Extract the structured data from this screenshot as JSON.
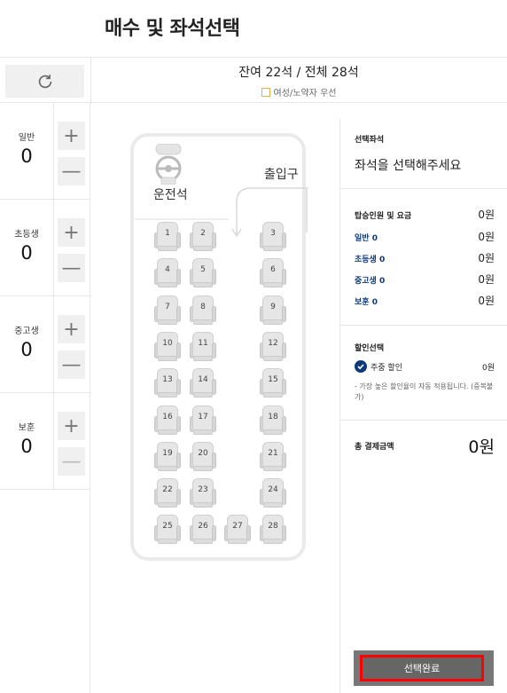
{
  "page": {
    "title": "매수 및 좌석선택"
  },
  "topbar": {
    "refresh_icon": "refresh-icon",
    "seat_summary": "잔여 22석 / 전체 28석",
    "priority_label": "여성/노약자 우선"
  },
  "counters": [
    {
      "label": "일반",
      "value": "0"
    },
    {
      "label": "초등생",
      "value": "0"
    },
    {
      "label": "중고생",
      "value": "0"
    },
    {
      "label": "보훈",
      "value": "0"
    }
  ],
  "counter_buttons": {
    "plus": "+",
    "minus": "—"
  },
  "bus": {
    "driver_label": "운전석",
    "exit_label": "출입구",
    "seats": [
      "1",
      "2",
      "3",
      "4",
      "5",
      "6",
      "7",
      "8",
      "9",
      "10",
      "11",
      "12",
      "13",
      "14",
      "15",
      "16",
      "17",
      "18",
      "19",
      "20",
      "21",
      "22",
      "23",
      "24",
      "25",
      "26",
      "27",
      "28"
    ]
  },
  "right": {
    "selected_seat_title": "선택좌석",
    "selected_seat_msg": "좌석을 선택해주세요",
    "fare_title": "탑승인원 및 요금",
    "fare_total": "0원",
    "fares": [
      {
        "label": "일반 0",
        "value": "0원"
      },
      {
        "label": "초등생 0",
        "value": "0원"
      },
      {
        "label": "중고생 0",
        "value": "0원"
      },
      {
        "label": "보훈 0",
        "value": "0원"
      }
    ],
    "discount_title": "할인선택",
    "discount_label": "주중 할인",
    "discount_value": "0원",
    "discount_note": "- 가장 높은 할인율이 자동 적용됩니다. (중복불가)",
    "total_label": "총 결제금액",
    "total_value": "0원",
    "complete_button": "선택완료"
  },
  "colors": {
    "accent": "#0d3a7a",
    "highlight": "#ff0000",
    "priority_box": "#e8a84c"
  }
}
